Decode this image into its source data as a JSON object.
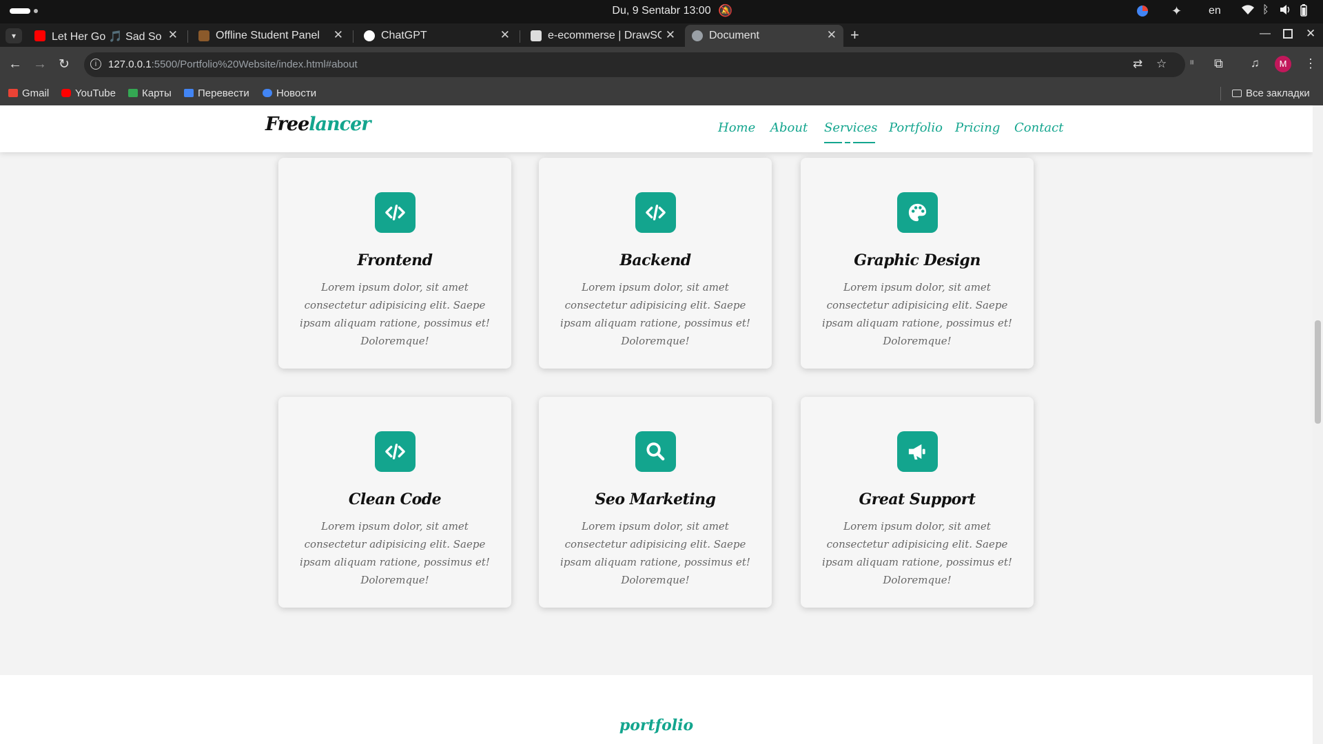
{
  "system": {
    "datetime": "Du, 9 Sentabr  13:00",
    "language": "en"
  },
  "tabs": [
    {
      "title": "Let Her Go 🎵 Sad Songs",
      "favicon_color": "#ff0000"
    },
    {
      "title": "Offline Student Panel",
      "favicon_color": "#8b5a2b"
    },
    {
      "title": "ChatGPT",
      "favicon_color": "#ffffff"
    },
    {
      "title": "e-ecommerse | DrawSQL",
      "favicon_color": "#dddddd"
    },
    {
      "title": "Document",
      "favicon_color": "#9aa0a6"
    }
  ],
  "address": {
    "host": "127.0.0.1",
    "path": ":5500/Portfolio%20Website/index.html#about"
  },
  "bookmarks": [
    {
      "label": "Gmail",
      "color": "#ea4335"
    },
    {
      "label": "YouTube",
      "color": "#ff0000"
    },
    {
      "label": "Карты",
      "color": "#34a853"
    },
    {
      "label": "Перевести",
      "color": "#4285f4"
    },
    {
      "label": "Новости",
      "color": "#4285f4"
    }
  ],
  "all_bookmarks": "Все закладки",
  "profile_initial": "M",
  "site": {
    "logo_main": "Free",
    "logo_accent": "lancer",
    "menu": [
      "Home",
      "About",
      "Services",
      "Portfolio",
      "Pricing",
      "Contact"
    ],
    "active_menu": "Services",
    "accent_color": "#13a58e"
  },
  "services": [
    {
      "icon": "code-icon",
      "title": "Frontend",
      "text": "Lorem ipsum dolor, sit amet consectetur adipisicing elit. Saepe ipsam aliquam ratione, possimus et! Doloremque!"
    },
    {
      "icon": "code-icon",
      "title": "Backend",
      "text": "Lorem ipsum dolor, sit amet consectetur adipisicing elit. Saepe ipsam aliquam ratione, possimus et! Doloremque!"
    },
    {
      "icon": "palette-icon",
      "title": "Graphic Design",
      "text": "Lorem ipsum dolor, sit amet consectetur adipisicing elit. Saepe ipsam aliquam ratione, possimus et! Doloremque!"
    },
    {
      "icon": "code-icon",
      "title": "Clean Code",
      "text": "Lorem ipsum dolor, sit amet consectetur adipisicing elit. Saepe ipsam aliquam ratione, possimus et! Doloremque!"
    },
    {
      "icon": "search-icon",
      "title": "Seo Marketing",
      "text": "Lorem ipsum dolor, sit amet consectetur adipisicing elit. Saepe ipsam aliquam ratione, possimus et! Doloremque!"
    },
    {
      "icon": "megaphone-icon",
      "title": "Great Support",
      "text": "Lorem ipsum dolor, sit amet consectetur adipisicing elit. Saepe ipsam aliquam ratione, possimus et! Doloremque!"
    }
  ],
  "portfolio_title": "portfolio"
}
